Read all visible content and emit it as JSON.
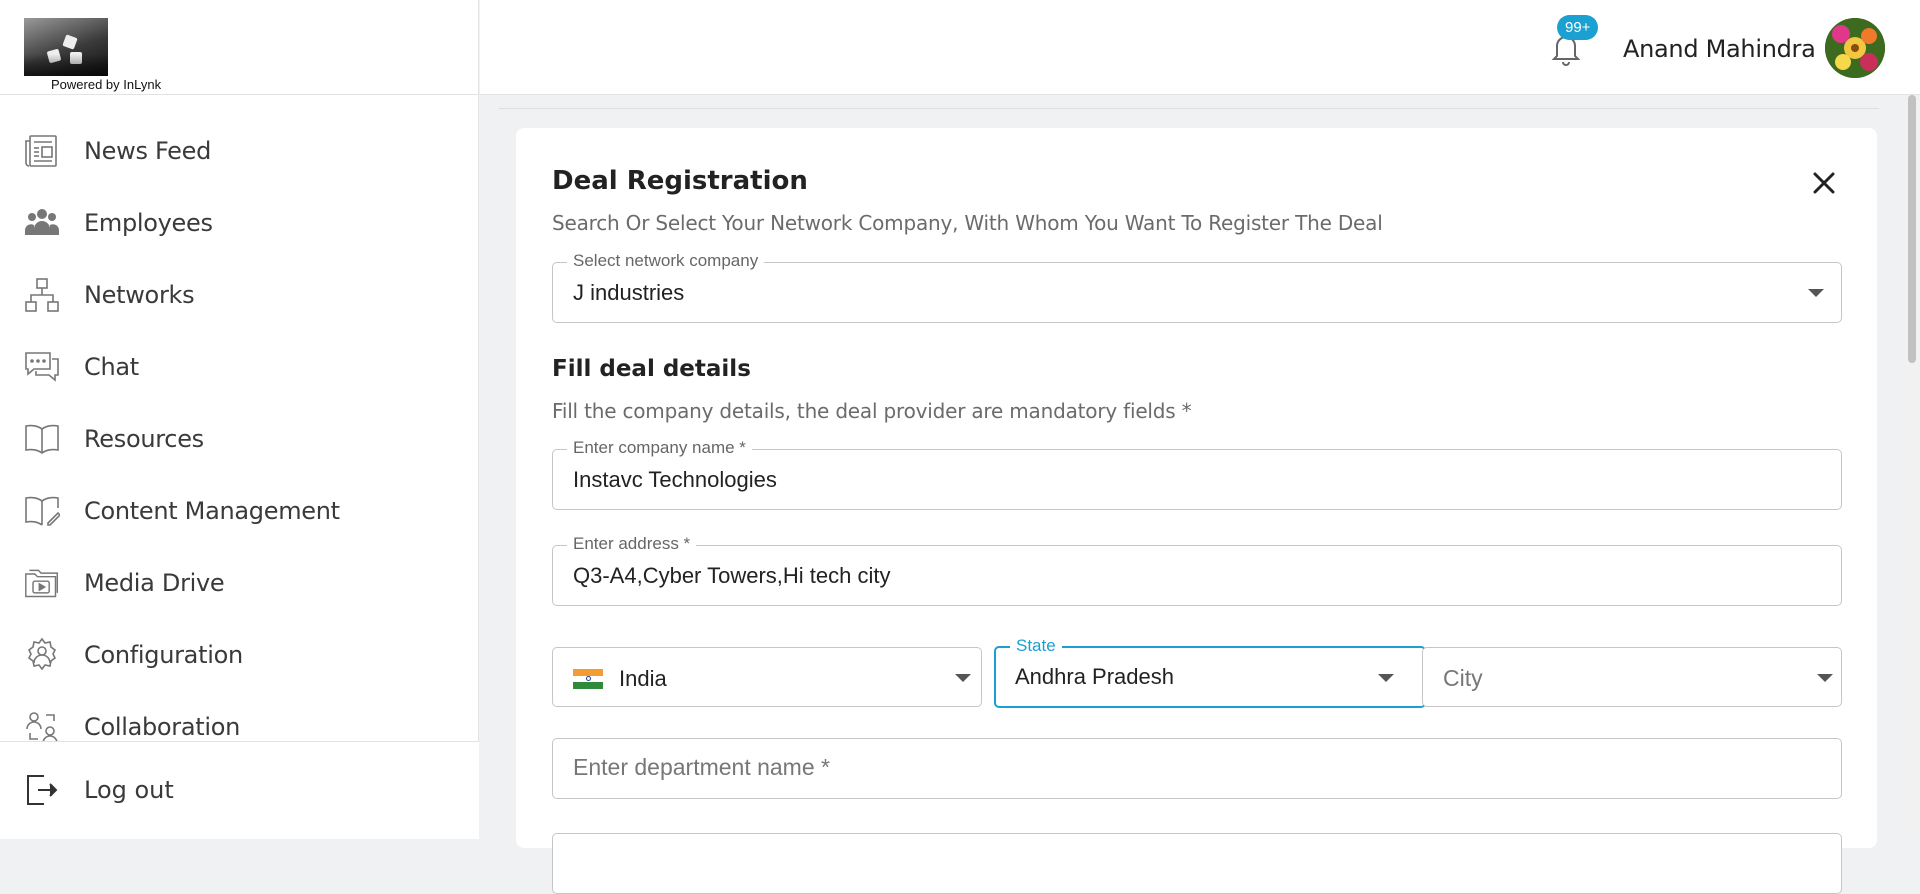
{
  "brand": {
    "powered_by": "Powered by InLynk"
  },
  "sidebar": {
    "items": [
      {
        "label": "News Feed",
        "icon": "newspaper-icon"
      },
      {
        "label": "Employees",
        "icon": "people-icon"
      },
      {
        "label": "Networks",
        "icon": "network-icon"
      },
      {
        "label": "Chat",
        "icon": "chat-icon"
      },
      {
        "label": "Resources",
        "icon": "book-icon"
      },
      {
        "label": "Content Management",
        "icon": "edit-book-icon"
      },
      {
        "label": "Media Drive",
        "icon": "media-folder-icon"
      },
      {
        "label": "Configuration",
        "icon": "gear-person-icon"
      },
      {
        "label": "Collaboration",
        "icon": "collaboration-icon"
      }
    ],
    "logout_label": "Log out"
  },
  "header": {
    "notification_count": "99+",
    "user_name": "Anand Mahindra"
  },
  "form": {
    "title": "Deal Registration",
    "subtitle": "Search Or Select Your Network Company, With Whom You Want To Register The Deal",
    "network_company": {
      "label": "Select network company",
      "value": "J industries"
    },
    "section_title": "Fill deal details",
    "section_subtitle": "Fill the company details, the deal provider are mandatory fields *",
    "company_name": {
      "label": "Enter company name *",
      "value": "Instavc Technologies"
    },
    "address": {
      "label": "Enter address *",
      "value": "Q3-A4,Cyber Towers,Hi tech city"
    },
    "country": {
      "value": "India"
    },
    "state": {
      "label": "State",
      "value": "Andhra Pradesh"
    },
    "city": {
      "placeholder": "City"
    },
    "department": {
      "placeholder": "Enter department name *"
    }
  },
  "colors": {
    "accent": "#1c9fd1",
    "text": "#222222",
    "muted": "#6b6b6b"
  }
}
